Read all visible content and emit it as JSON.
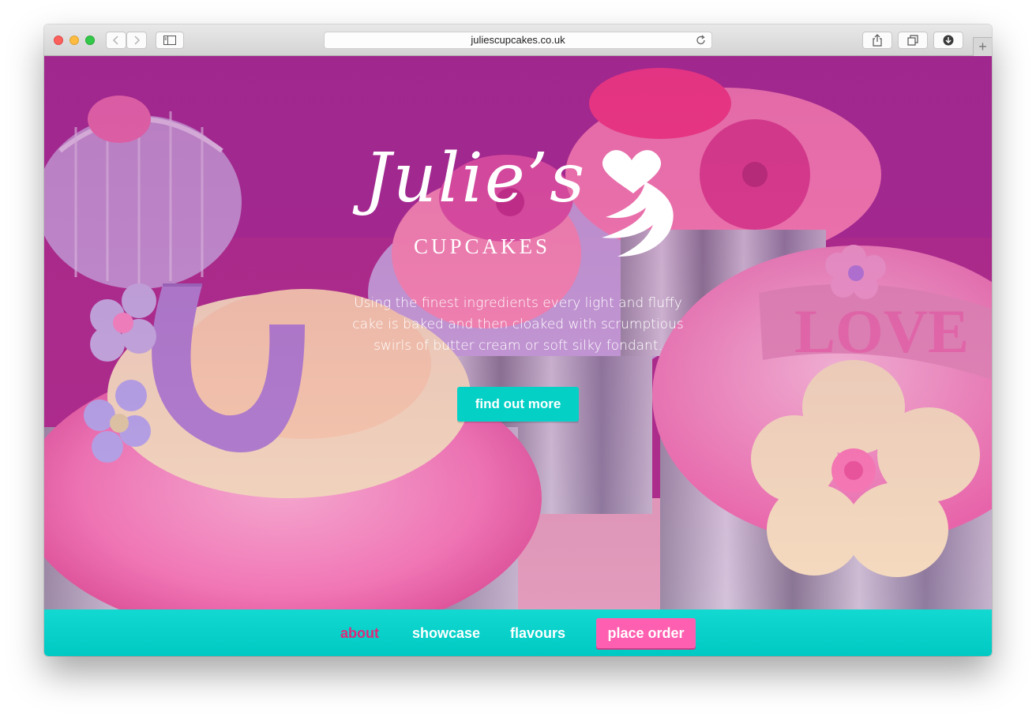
{
  "browser": {
    "url": "juliescupcakes.co.uk"
  },
  "hero": {
    "logo_script": "Julie’s",
    "logo_sub": "CUPCAKES",
    "tagline": "Using the finest ingredients every light and fluffy cake is baked and then cloaked with scrumptious swirls of butter cream or soft silky fondant.",
    "cta_label": "find out more"
  },
  "nav": {
    "items": [
      {
        "label": "about",
        "active": true
      },
      {
        "label": "showcase",
        "active": false
      },
      {
        "label": "flavours",
        "active": false
      }
    ],
    "order_label": "place order"
  },
  "colors": {
    "accent": "#05d0c6",
    "order_button": "#ff5fb0",
    "active_nav": "#e0287a"
  },
  "icons": [
    "close-icon",
    "minimize-icon",
    "zoom-icon",
    "back-icon",
    "forward-icon",
    "sidebar-icon",
    "reload-icon",
    "share-icon",
    "tabs-icon",
    "download-icon",
    "plus-icon",
    "heart-cupcake-logo-icon"
  ]
}
